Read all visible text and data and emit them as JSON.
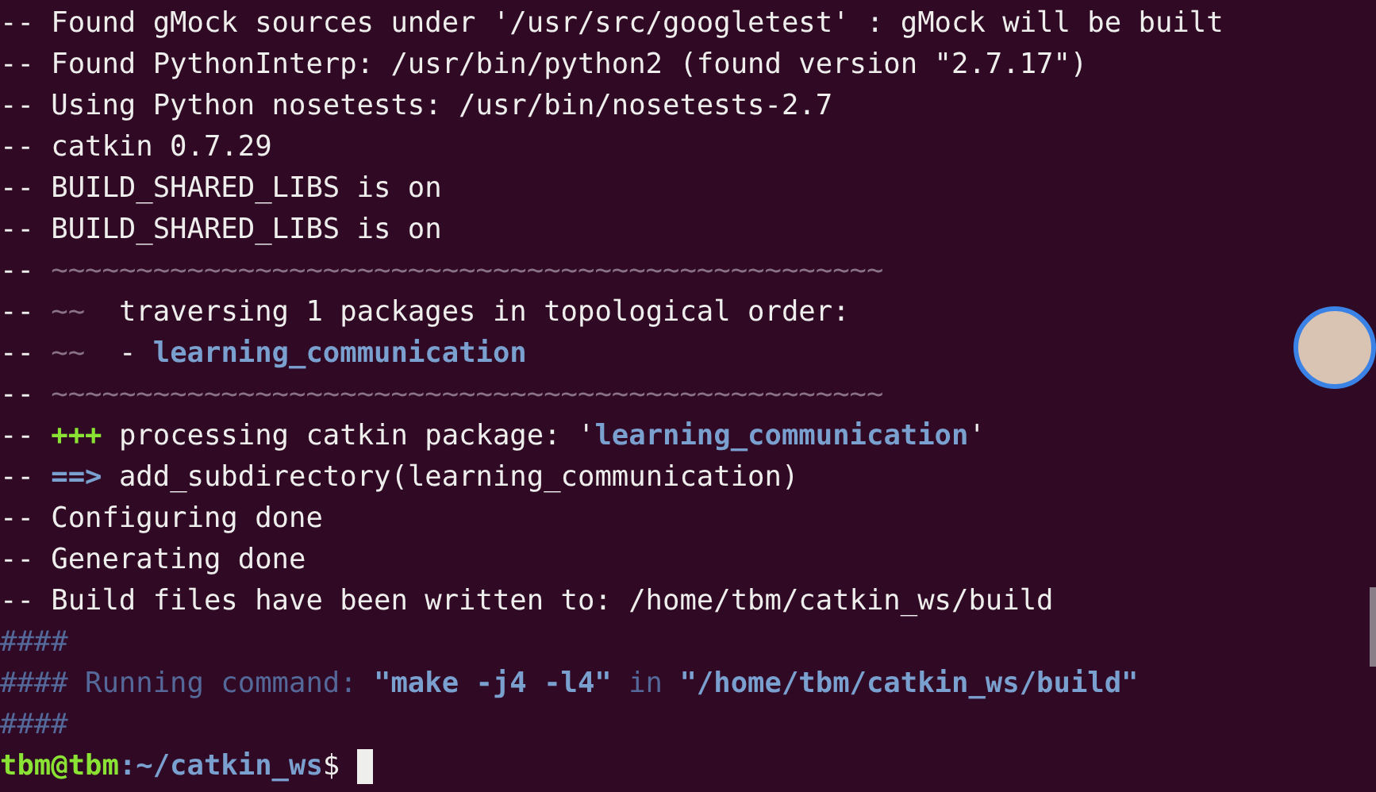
{
  "terminal": {
    "lines": [
      {
        "segments": [
          {
            "kind": "plain",
            "text": "-- Found gMock sources under '/usr/src/googletest' : gMock will be built"
          }
        ]
      },
      {
        "segments": [
          {
            "kind": "plain",
            "text": "-- Found PythonInterp: /usr/bin/python2 (found version \"2.7.17\")"
          }
        ]
      },
      {
        "segments": [
          {
            "kind": "plain",
            "text": "-- Using Python nosetests: /usr/bin/nosetests-2.7"
          }
        ]
      },
      {
        "segments": [
          {
            "kind": "plain",
            "text": "-- catkin 0.7.29"
          }
        ]
      },
      {
        "segments": [
          {
            "kind": "plain",
            "text": "-- BUILD_SHARED_LIBS is on"
          }
        ]
      },
      {
        "segments": [
          {
            "kind": "plain",
            "text": "-- BUILD_SHARED_LIBS is on"
          }
        ]
      },
      {
        "segments": [
          {
            "kind": "plain",
            "text": "-- "
          },
          {
            "kind": "dim",
            "text": "~~~~~~~~~~~~~~~~~~~~~~~~~~~~~~~~~~~~~~~~~~~~~~~~~"
          }
        ]
      },
      {
        "segments": [
          {
            "kind": "plain",
            "text": "-- "
          },
          {
            "kind": "dim",
            "text": "~~"
          },
          {
            "kind": "plain",
            "text": "  traversing 1 packages in topological order:"
          }
        ]
      },
      {
        "segments": [
          {
            "kind": "plain",
            "text": "-- "
          },
          {
            "kind": "dim",
            "text": "~~"
          },
          {
            "kind": "plain",
            "text": "  - "
          },
          {
            "kind": "blue",
            "text": "learning_communication"
          }
        ]
      },
      {
        "segments": [
          {
            "kind": "plain",
            "text": "-- "
          },
          {
            "kind": "dim",
            "text": "~~~~~~~~~~~~~~~~~~~~~~~~~~~~~~~~~~~~~~~~~~~~~~~~~"
          }
        ]
      },
      {
        "segments": [
          {
            "kind": "plain",
            "text": "-- "
          },
          {
            "kind": "green",
            "text": "+++"
          },
          {
            "kind": "plain",
            "text": " processing catkin package: '"
          },
          {
            "kind": "blue",
            "text": "learning_communication"
          },
          {
            "kind": "plain",
            "text": "'"
          }
        ]
      },
      {
        "segments": [
          {
            "kind": "plain",
            "text": "-- "
          },
          {
            "kind": "blue",
            "text": "==>"
          },
          {
            "kind": "plain",
            "text": " add_subdirectory(learning_communication)"
          }
        ]
      },
      {
        "segments": [
          {
            "kind": "plain",
            "text": "-- Configuring done"
          }
        ]
      },
      {
        "segments": [
          {
            "kind": "plain",
            "text": "-- Generating done"
          }
        ]
      },
      {
        "segments": [
          {
            "kind": "plain",
            "text": "-- Build files have been written to: /home/tbm/catkin_ws/build"
          }
        ]
      },
      {
        "segments": [
          {
            "kind": "dimblue",
            "text": "####"
          }
        ]
      },
      {
        "segments": [
          {
            "kind": "dimblue",
            "text": "#### Running command: "
          },
          {
            "kind": "blue",
            "text": "\"make -j4 -l4\""
          },
          {
            "kind": "dimblue",
            "text": " in "
          },
          {
            "kind": "blue",
            "text": "\"/home/tbm/catkin_ws/build\""
          }
        ]
      },
      {
        "segments": [
          {
            "kind": "dimblue",
            "text": "####"
          }
        ]
      }
    ],
    "prompt": {
      "user_host": "tbm@tbm",
      "path": ":~/catkin_ws",
      "symbol": "$"
    }
  }
}
